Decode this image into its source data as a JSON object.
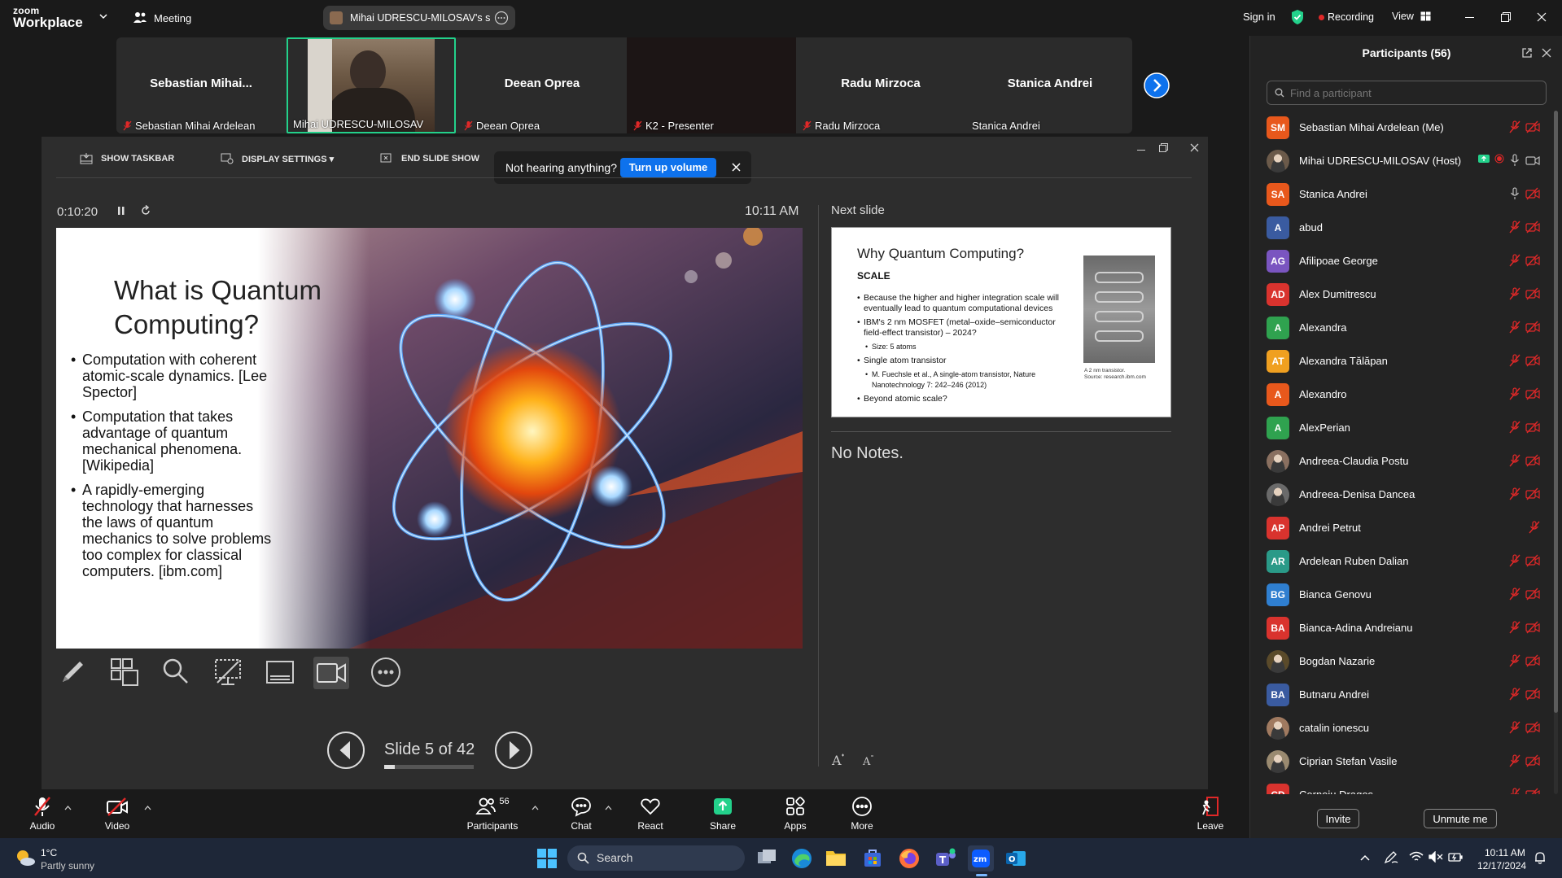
{
  "app": {
    "logo_line1": "zoom",
    "logo_line2": "Workplace",
    "meeting_label": "Meeting",
    "share_title": "Mihai UDRESCU-MILOSAV's scree",
    "sign_in": "Sign in",
    "recording": "Recording",
    "view": "View"
  },
  "thumbnails": [
    {
      "big": "Sebastian  Mihai...",
      "label": "Sebastian Mihai Ardelean",
      "muted": true
    },
    {
      "big": "",
      "label": "Mihai UDRESCU-MILOSAV",
      "muted": false,
      "video": true
    },
    {
      "big": "Deean Oprea",
      "label": "Deean Oprea",
      "muted": true
    },
    {
      "big": "",
      "label": "K2 - Presenter",
      "muted": true
    },
    {
      "big": "Radu Mirzoca",
      "label": "Radu Mirzoca",
      "muted": true
    },
    {
      "big": "Stanica Andrei",
      "label": "Stanica Andrei",
      "muted": false
    }
  ],
  "presenter": {
    "show_taskbar": "SHOW TASKBAR",
    "display_settings": "DISPLAY SETTINGS ▾",
    "end_show": "END SLIDE SHOW",
    "toast_text": "Not hearing anything?",
    "toast_button": "Turn up volume",
    "timer": "0:10:20",
    "clock": "10:11 AM",
    "next_slide_label": "Next slide",
    "notes": "No Notes.",
    "slide_counter": "Slide 5 of 42",
    "slide_progress": 0.119
  },
  "slide": {
    "title": "What is Quantum Computing?",
    "bullets": [
      "Computation with coherent atomic-scale dynamics. [Lee Spector]",
      "Computation that takes advantage of quantum mechanical phenomena. [Wikipedia]",
      "A rapidly-emerging technology that harnesses the laws of quantum mechanics to solve problems too complex for classical computers. [ibm.com]"
    ]
  },
  "next_slide": {
    "title": "Why Quantum Computing?",
    "subtitle": "SCALE",
    "b1": "Because the higher and higher integration scale will eventually lead to quantum computational devices",
    "b2": "IBM's 2 nm MOSFET (metal–oxide–semiconductor field-effect transistor) – 2024?",
    "b2_sub": "Size: 5 atoms",
    "b3": "Single atom transistor",
    "b3_sub": "M. Fuechsle et al., A single-atom transistor, Nature Nanotechnology 7: 242–246 (2012)",
    "b4": "Beyond atomic scale?",
    "caption1": "A 2 nm transistor.",
    "caption2": "Source: research.ibm.com"
  },
  "bottombar": {
    "audio": "Audio",
    "video": "Video",
    "participants": "Participants",
    "participants_count": "56",
    "chat": "Chat",
    "react": "React",
    "share": "Share",
    "apps": "Apps",
    "more": "More",
    "leave": "Leave"
  },
  "panel": {
    "title": "Participants (56)",
    "search_placeholder": "Find a participant",
    "invite": "Invite",
    "unmute": "Unmute me",
    "participants": [
      {
        "name": "Sebastian Mihai Ardelean (Me)",
        "initials": "SM",
        "color": "#e8581c"
      },
      {
        "name": "Mihai UDRESCU-MILOSAV (Host)",
        "initials": "",
        "color": "#6b5a4a",
        "photo": true,
        "host": true
      },
      {
        "name": "Stanica Andrei",
        "initials": "SA",
        "color": "#e8581c",
        "mic_on": true
      },
      {
        "name": "abud",
        "initials": "A",
        "color": "#3a5ba0"
      },
      {
        "name": "Afilipoae George",
        "initials": "AG",
        "color": "#7a55c0"
      },
      {
        "name": "Alex Dumitrescu",
        "initials": "AD",
        "color": "#d9332e"
      },
      {
        "name": "Alexandra",
        "initials": "A",
        "color": "#2fa24f"
      },
      {
        "name": "Alexandra Tălăpan",
        "initials": "AT",
        "color": "#f0a020"
      },
      {
        "name": "Alexandro",
        "initials": "A",
        "color": "#e8581c"
      },
      {
        "name": "AlexPerian",
        "initials": "A",
        "color": "#2fa24f"
      },
      {
        "name": "Andreea-Claudia Postu",
        "initials": "",
        "color": "#8a7060",
        "photo": true
      },
      {
        "name": "Andreea-Denisa Dancea",
        "initials": "",
        "color": "#6a6a6a",
        "photo": true
      },
      {
        "name": "Andrei Petrut",
        "initials": "AP",
        "color": "#d9332e",
        "no_video": true
      },
      {
        "name": "Ardelean Ruben Dalian",
        "initials": "AR",
        "color": "#2a9a88"
      },
      {
        "name": "Bianca Genovu",
        "initials": "BG",
        "color": "#2f7fd0"
      },
      {
        "name": "Bianca-Adina Andreianu",
        "initials": "BA",
        "color": "#d9332e"
      },
      {
        "name": "Bogdan Nazarie",
        "initials": "",
        "color": "#5a4a2a",
        "photo": true
      },
      {
        "name": "Butnaru Andrei",
        "initials": "BA",
        "color": "#3a5ba0"
      },
      {
        "name": "catalin ionescu",
        "initials": "",
        "color": "#a07a60",
        "photo": true
      },
      {
        "name": "Ciprian Stefan Vasile",
        "initials": "",
        "color": "#9a8a70",
        "photo": true
      },
      {
        "name": "Cornoiu Dragos",
        "initials": "CD",
        "color": "#d9332e"
      }
    ]
  },
  "taskbar": {
    "weather_temp": "1°C",
    "weather_desc": "Partly sunny",
    "search": "Search",
    "time": "10:11 AM",
    "date": "12/17/2024"
  },
  "colors": {
    "accent": "#0e72ed",
    "muted_red": "#e02828",
    "active_green": "#23d18b"
  }
}
